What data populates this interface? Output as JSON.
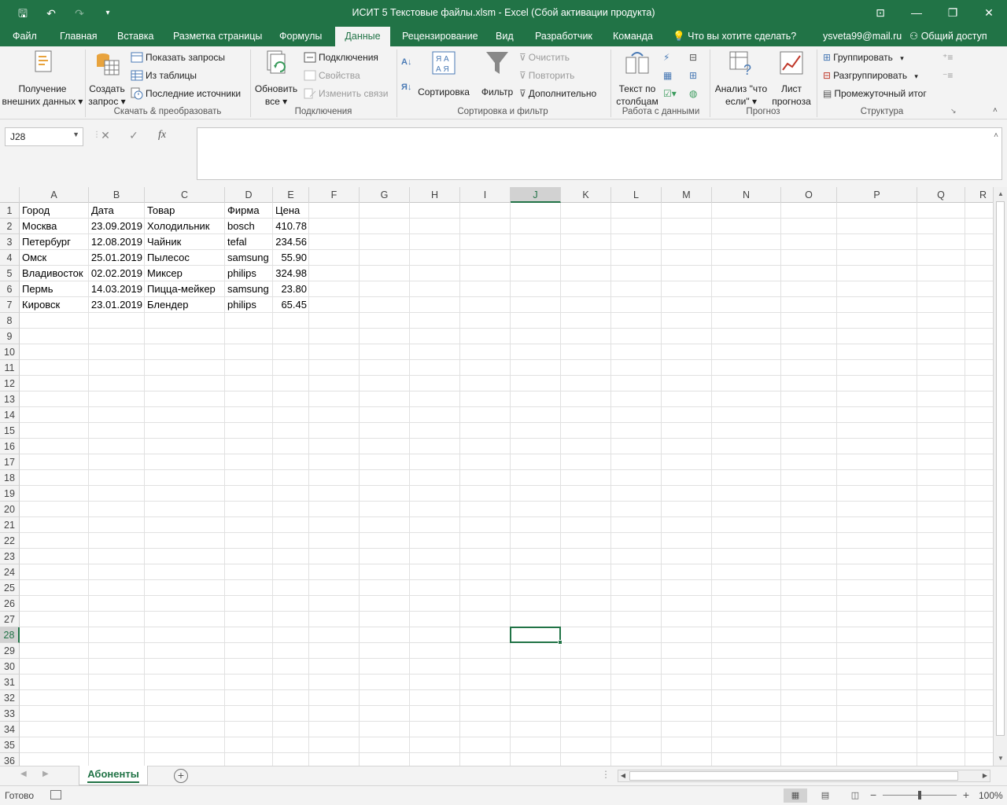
{
  "titlebar": {
    "title": "ИСИТ 5 Текстовые файлы.xlsm - Excel (Сбой активации продукта)"
  },
  "tabs": {
    "file": "Файл",
    "home": "Главная",
    "insert": "Вставка",
    "layout": "Разметка страницы",
    "formulas": "Формулы",
    "data": "Данные",
    "review": "Рецензирование",
    "view": "Вид",
    "developer": "Разработчик",
    "team": "Команда",
    "tell_me": "Что вы хотите сделать?",
    "user": "ysveta99@mail.ru",
    "share": "Общий доступ"
  },
  "ribbon": {
    "get_external": [
      "Получение",
      "внешних данных"
    ],
    "new_query": [
      "Создать",
      "запрос"
    ],
    "show_queries": "Показать запросы",
    "from_table": "Из таблицы",
    "recent_sources": "Последние источники",
    "group_get_transform": "Скачать & преобразовать",
    "refresh_all": [
      "Обновить",
      "все"
    ],
    "connections": "Подключения",
    "properties": "Свойства",
    "edit_links": "Изменить связи",
    "group_connections": "Подключения",
    "sort": "Сортировка",
    "filter": "Фильтр",
    "clear": "Очистить",
    "reapply": "Повторить",
    "advanced": "Дополнительно",
    "group_sort_filter": "Сортировка и фильтр",
    "text_to_columns": [
      "Текст по",
      "столбцам"
    ],
    "group_data_tools": "Работа с данными",
    "what_if": [
      "Анализ \"что",
      "если\""
    ],
    "forecast_sheet": [
      "Лист",
      "прогноза"
    ],
    "group_forecast": "Прогноз",
    "group": "Группировать",
    "ungroup": "Разгруппировать",
    "subtotal": "Промежуточный итог",
    "group_outline": "Структура"
  },
  "formula_bar": {
    "name_box": "J28",
    "formula": ""
  },
  "sheet": {
    "columns": [
      "A",
      "B",
      "C",
      "D",
      "E",
      "F",
      "G",
      "H",
      "I",
      "J",
      "K",
      "L",
      "M",
      "N",
      "O",
      "P",
      "Q",
      "R"
    ],
    "row_count": 36,
    "rows": [
      [
        "Город",
        "Дата",
        "Товар",
        "Фирма",
        "Цена"
      ],
      [
        "Москва",
        "23.09.2019",
        "Холодильник",
        "bosch",
        "410.78"
      ],
      [
        "Петербург",
        "12.08.2019",
        "Чайник",
        "tefal",
        "234.56"
      ],
      [
        "Омск",
        "25.01.2019",
        "Пылесос",
        "samsung",
        "55.90"
      ],
      [
        "Владивосток",
        "02.02.2019",
        "Миксер",
        "philips",
        "324.98"
      ],
      [
        "Пермь",
        "14.03.2019",
        "Пицца-мейкер",
        "samsung",
        "23.80"
      ],
      [
        "Кировск",
        "23.01.2019",
        "Блендер",
        "philips",
        "65.45"
      ]
    ],
    "active_cell": "J28",
    "sheet_tab": "Абоненты"
  },
  "status": {
    "ready": "Готово",
    "zoom": "100%",
    "zoom_level_fraction": 0.5
  },
  "colors": {
    "accent": "#217346"
  }
}
